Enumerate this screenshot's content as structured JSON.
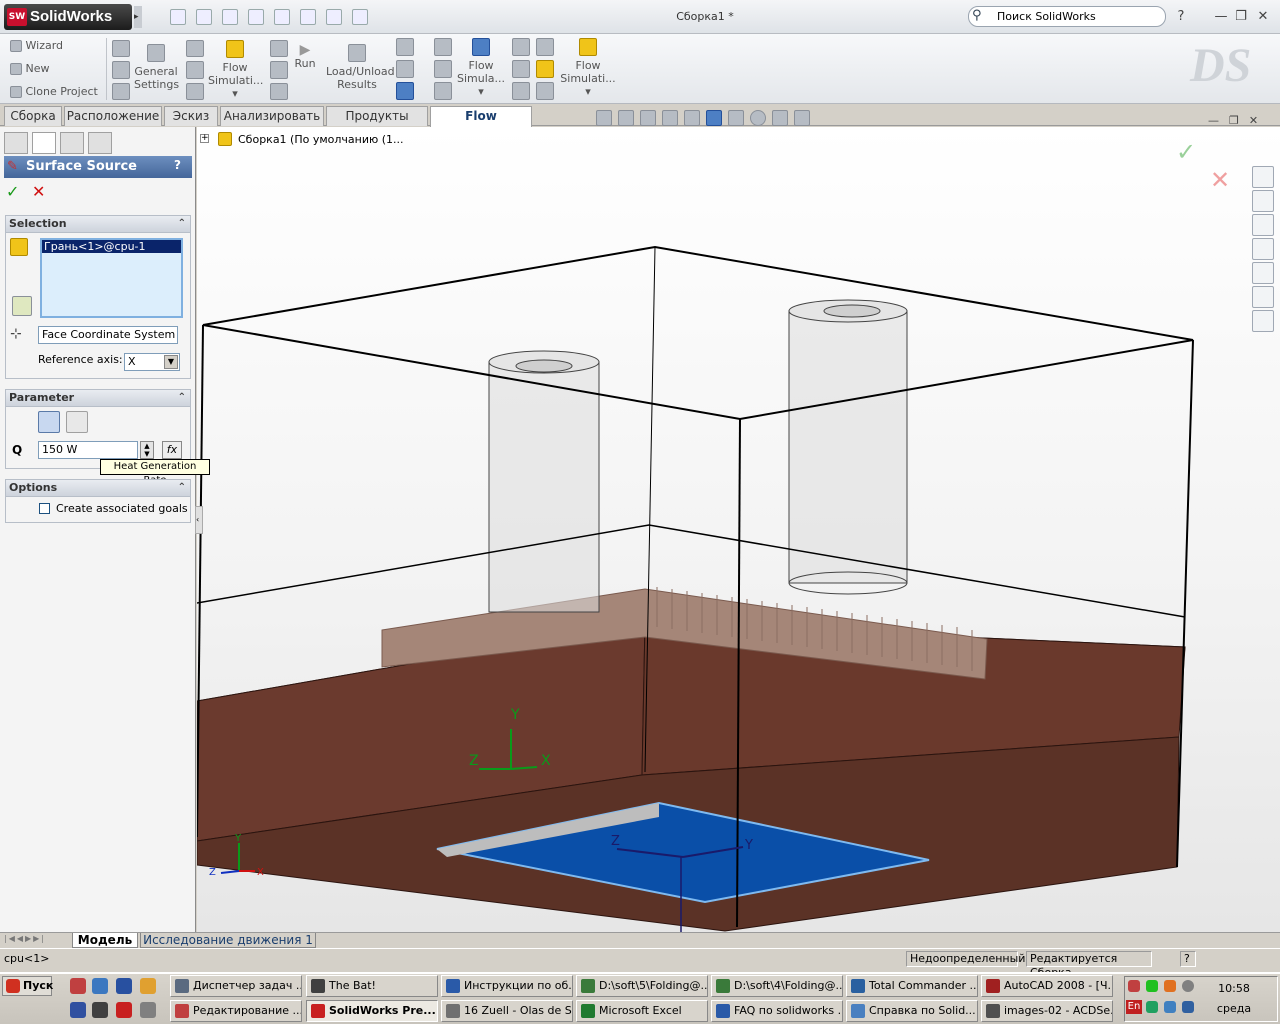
{
  "app": {
    "brand": "SolidWorks",
    "doc_title": "Сборка1 *"
  },
  "search": {
    "placeholder": "Поиск SolidWorks"
  },
  "window_controls": {
    "help": "?",
    "minimize": "—",
    "restore": "❐",
    "close": "✕"
  },
  "command_manager": {
    "wizard": "Wizard",
    "new": "New",
    "clone_project": "Clone Project",
    "general_settings_1": "General",
    "general_settings_2": "Settings",
    "flow_simulation_1": "Flow",
    "flow_simulation_2": "Simulati...",
    "run": "Run",
    "load_unload_1": "Load/Unload",
    "load_unload_2": "Results",
    "flow_simulation_b1": "Flow",
    "flow_simulation_b2": "Simula...",
    "flow_simulation_c1": "Flow",
    "flow_simulation_c2": "Simulati..."
  },
  "tabs": [
    "Сборка",
    "Расположение",
    "Эскиз",
    "Анализировать",
    "Продукты Office",
    "Flow Simulation"
  ],
  "active_tab": "Flow Simulation",
  "tree": {
    "root": "Сборка1  (По умолчанию (1..."
  },
  "property_manager": {
    "title": "Surface Source",
    "help": "?",
    "selection": {
      "header": "Selection",
      "item": "Грань<1>@cpu-1",
      "coord_system": "Face Coordinate System",
      "ref_axis_label": "Reference axis:",
      "ref_axis_value": "X"
    },
    "parameter": {
      "header": "Parameter",
      "q_label": "Q",
      "q_value": "150 W",
      "fx": "fx",
      "tooltip": "Heat Generation Rate"
    },
    "options": {
      "header": "Options",
      "goals_label": "Create associated goals",
      "goals_checked": false
    }
  },
  "axes": {
    "y": "Y",
    "z": "Z",
    "x": "X"
  },
  "bottom_tabs": [
    "Модель",
    "Исследование движения 1"
  ],
  "status": {
    "left": "cpu<1>",
    "state": "Недоопределенный",
    "editing": "Редактируется Сборка",
    "help": "?"
  },
  "taskbar": {
    "start": "Пуск",
    "row1": [
      "Диспетчер задач ...",
      "The Bat!",
      "Инструкции по об...",
      "D:\\soft\\5\\Folding@...",
      "D:\\soft\\4\\Folding@...",
      "Total Commander ...",
      "AutoCAD 2008 - [Ч..."
    ],
    "row2": [
      "Редактирование ...",
      "SolidWorks Pre...",
      "16 Zuell - Olas de S...",
      "Microsoft Excel",
      "FAQ по solidworks ...",
      "Справка по Solid...",
      "images-02 - ACDSe..."
    ],
    "active": "SolidWorks Pre...",
    "lang": "En",
    "time": "10:58",
    "day": "среда"
  },
  "colors": {
    "accent": "#0a246a",
    "heat_pad": "#0a4fa8",
    "pcb": "#6b3a2e",
    "heatsink": "#a58678"
  }
}
